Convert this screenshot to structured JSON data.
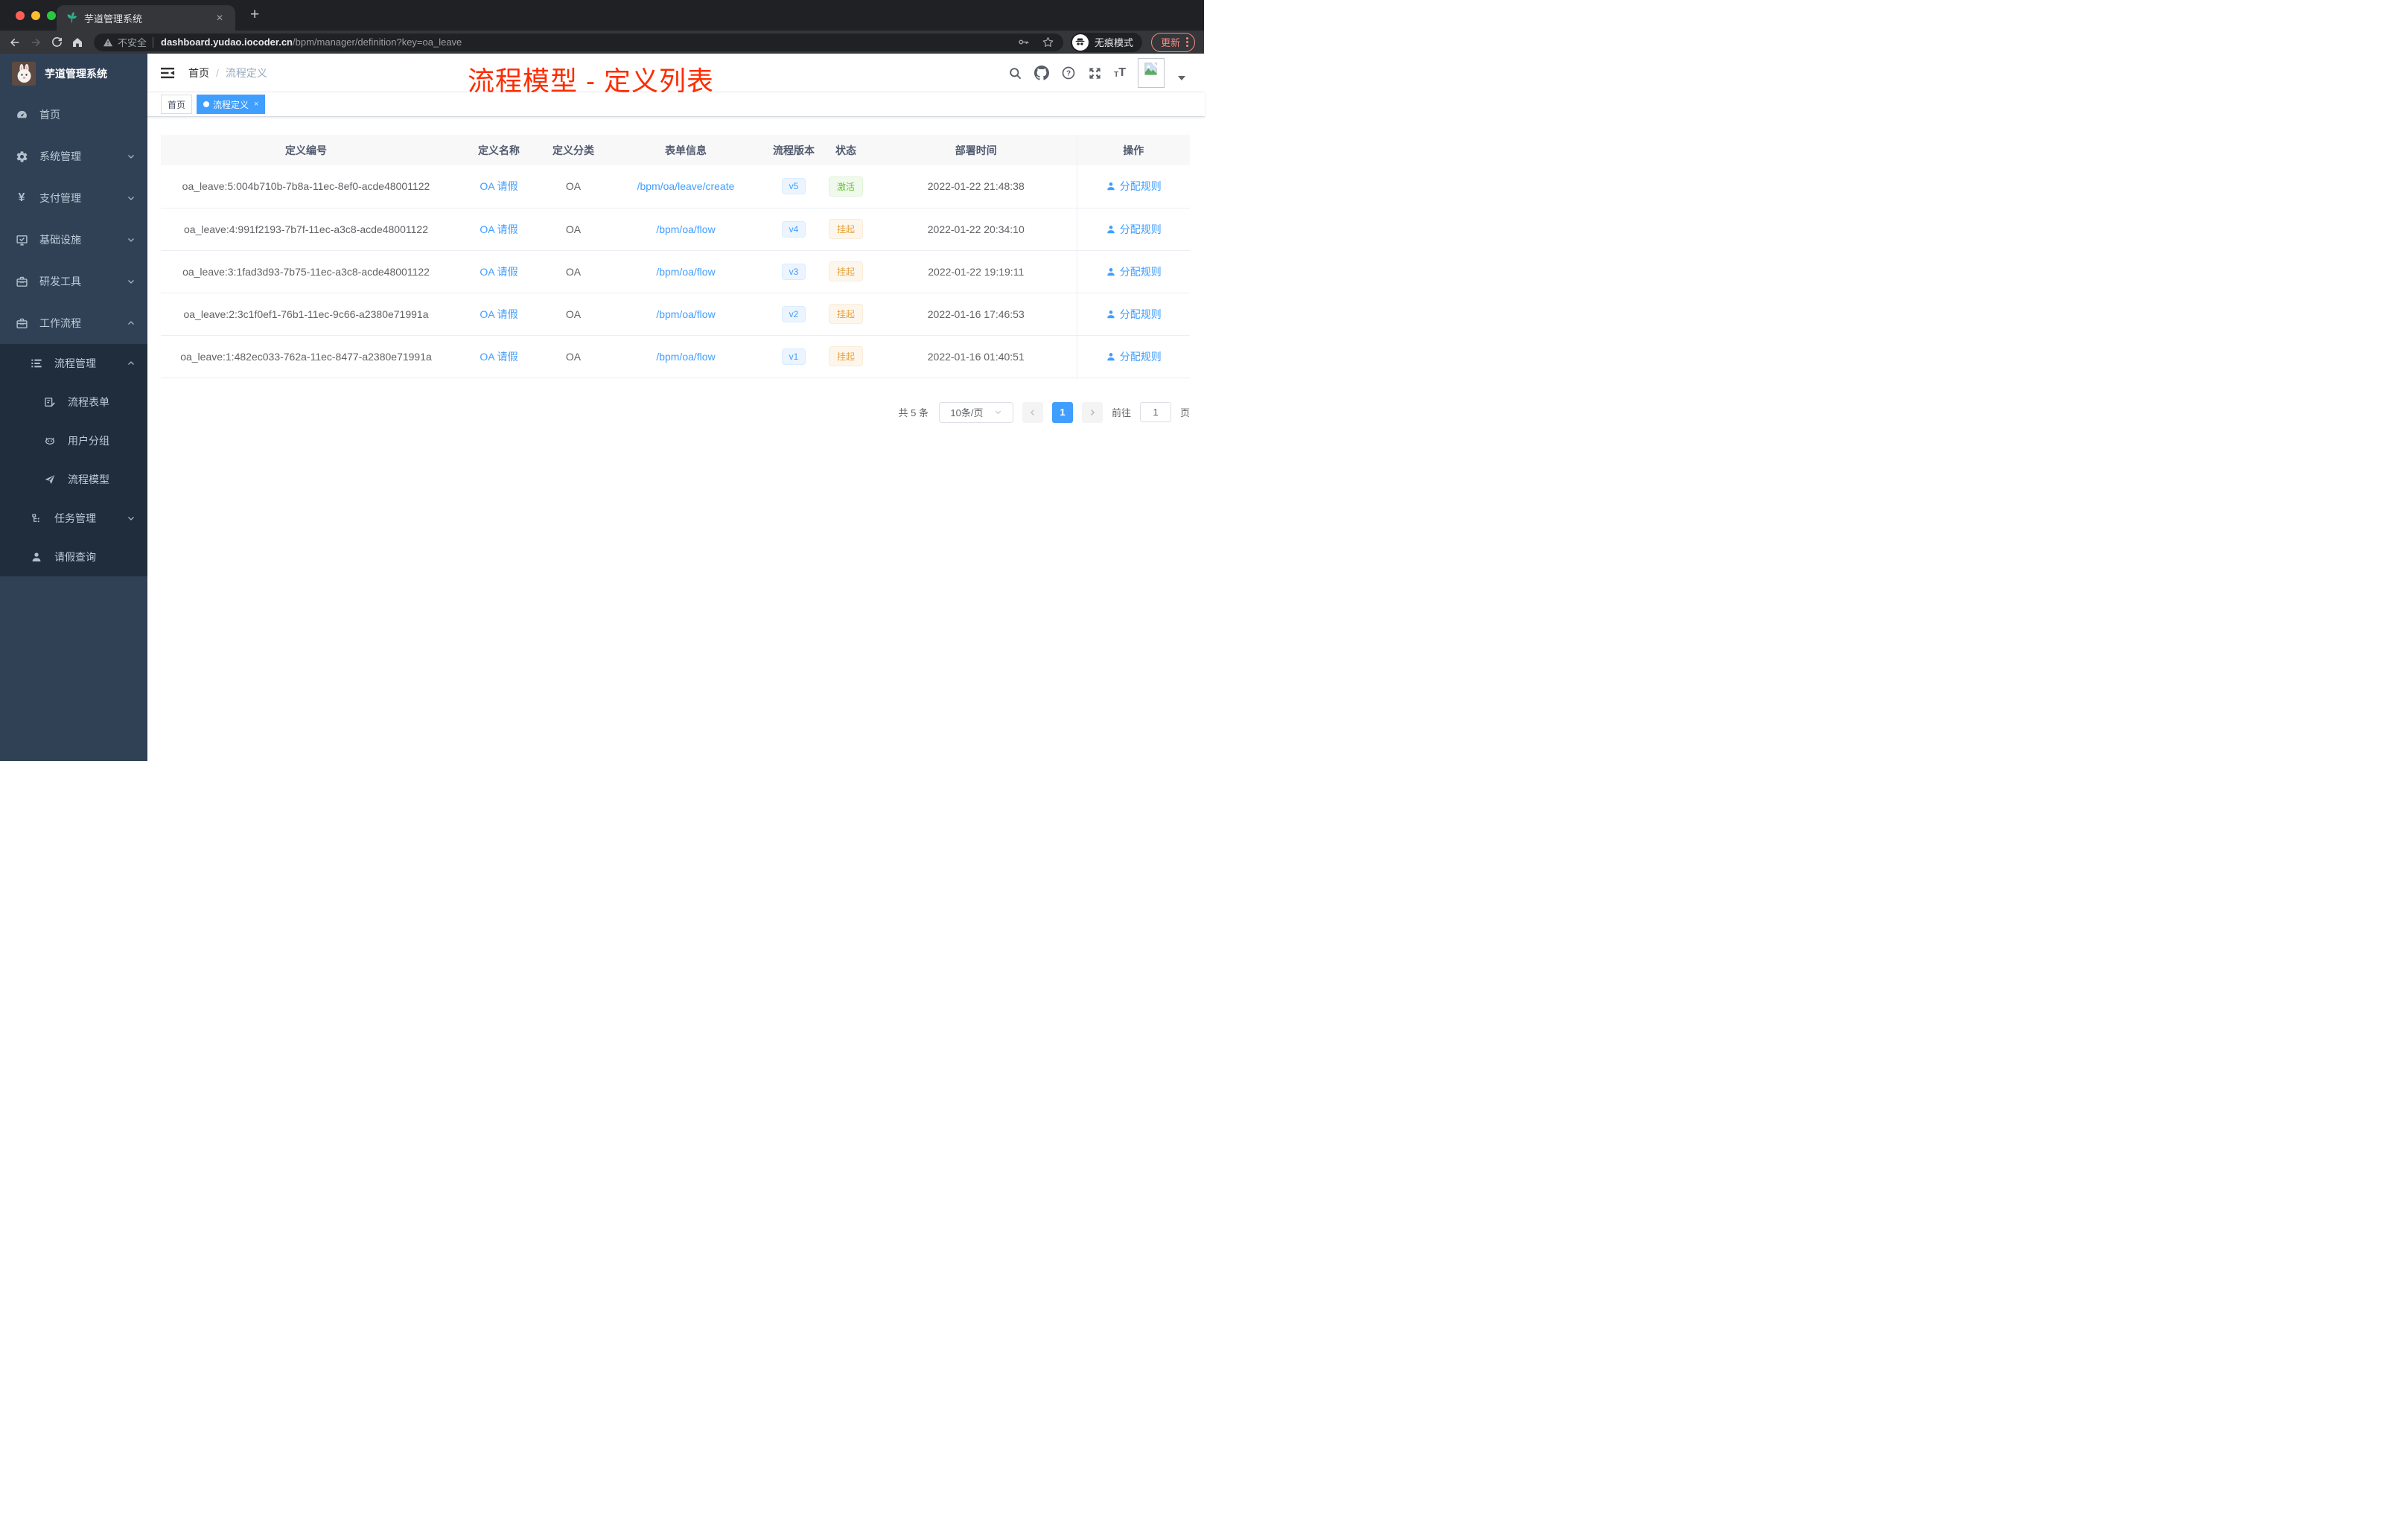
{
  "browser": {
    "tab": {
      "title": "芋道管理系统",
      "close_glyph": "✕",
      "new_tab_glyph": "+"
    },
    "address": {
      "security_label": "不安全",
      "host": "dashboard.yudao.iocoder.cn",
      "path": "/bpm/manager/definition?key=oa_leave"
    },
    "incognito_label": "无痕模式",
    "update_label": "更新"
  },
  "sidebar": {
    "logo_title": "芋道管理系统",
    "menu": {
      "home": "首页",
      "system": "系统管理",
      "payment": "支付管理",
      "infra": "基础设施",
      "devtools": "研发工具",
      "workflow": "工作流程"
    },
    "submenu": {
      "process_mgmt": "流程管理",
      "process_form": "流程表单",
      "user_group": "用户分组",
      "process_model": "流程模型",
      "task_mgmt": "任务管理",
      "leave_query": "请假查询"
    }
  },
  "navbar": {
    "breadcrumb": {
      "home": "首页",
      "separator": "/",
      "current": "流程定义"
    },
    "annotation": "流程模型 - 定义列表"
  },
  "tags_view": {
    "home": "首页",
    "active": "流程定义",
    "close_glyph": "×"
  },
  "table": {
    "columns": [
      "定义编号",
      "定义名称",
      "定义分类",
      "表单信息",
      "流程版本",
      "状态",
      "部署时间",
      "操作"
    ],
    "rows": [
      {
        "id": "oa_leave:5:004b710b-7b8a-11ec-8ef0-acde48001122",
        "name": "OA 请假",
        "category": "OA",
        "form": "/bpm/oa/leave/create",
        "version": "v5",
        "status": "激活",
        "deploy_time": "2022-01-22 21:48:38",
        "action": "分配规则"
      },
      {
        "id": "oa_leave:4:991f2193-7b7f-11ec-a3c8-acde48001122",
        "name": "OA 请假",
        "category": "OA",
        "form": "/bpm/oa/flow",
        "version": "v4",
        "status": "挂起",
        "deploy_time": "2022-01-22 20:34:10",
        "action": "分配规则"
      },
      {
        "id": "oa_leave:3:1fad3d93-7b75-11ec-a3c8-acde48001122",
        "name": "OA 请假",
        "category": "OA",
        "form": "/bpm/oa/flow",
        "version": "v3",
        "status": "挂起",
        "deploy_time": "2022-01-22 19:19:11",
        "action": "分配规则"
      },
      {
        "id": "oa_leave:2:3c1f0ef1-76b1-11ec-9c66-a2380e71991a",
        "name": "OA 请假",
        "category": "OA",
        "form": "/bpm/oa/flow",
        "version": "v2",
        "status": "挂起",
        "deploy_time": "2022-01-16 17:46:53",
        "action": "分配规则"
      },
      {
        "id": "oa_leave:1:482ec033-762a-11ec-8477-a2380e71991a",
        "name": "OA 请假",
        "category": "OA",
        "form": "/bpm/oa/flow",
        "version": "v1",
        "status": "挂起",
        "deploy_time": "2022-01-16 01:40:51",
        "action": "分配规则"
      }
    ]
  },
  "pagination": {
    "total": "共 5 条",
    "page_size": "10条/页",
    "current_page": "1",
    "goto_label": "前往",
    "goto_value": "1",
    "goto_unit": "页"
  },
  "colors": {
    "accent": "#409eff",
    "annotation": "#fe2c00",
    "status_active": "#67c23a",
    "status_suspended": "#e6a23c",
    "sidebar_bg": "#304156",
    "submenu_bg": "#1f2d3d",
    "update_chip": "#f28b82"
  }
}
